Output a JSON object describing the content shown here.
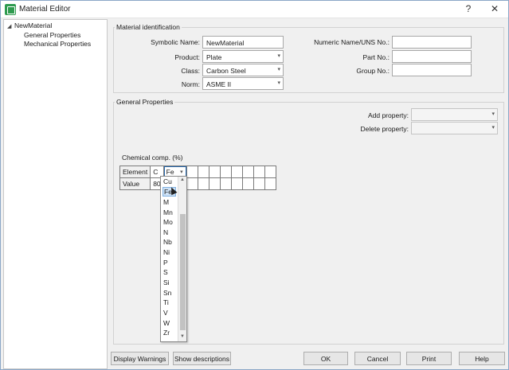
{
  "window": {
    "title": "Material Editor",
    "help_glyph": "?",
    "close_glyph": "✕"
  },
  "tree": {
    "root": "NewMaterial",
    "children": [
      "General Properties",
      "Mechanical Properties"
    ]
  },
  "identification": {
    "title": "Material identification",
    "symbolic_name_label": "Symbolic Name:",
    "symbolic_name_value": "NewMaterial",
    "product_label": "Product:",
    "product_value": "Plate",
    "class_label": "Class:",
    "class_value": "Carbon Steel",
    "norm_label": "Norm:",
    "norm_value": "ASME II",
    "numeric_name_label": "Numeric Name/UNS No.:",
    "numeric_name_value": "",
    "part_no_label": "Part No.:",
    "part_no_value": "",
    "group_no_label": "Group No.:",
    "group_no_value": ""
  },
  "general": {
    "title": "General Properties",
    "add_property_label": "Add property:",
    "delete_property_label": "Delete property:"
  },
  "chem": {
    "title": "Chemical comp. (%)",
    "element_label": "Element",
    "value_label": "Value",
    "elements": [
      "C",
      "Fe"
    ],
    "values": [
      "80",
      ""
    ]
  },
  "dropdown": {
    "items": [
      "Cu",
      "Fe",
      "M",
      "Mn",
      "Mo",
      "N",
      "Nb",
      "Ni",
      "P",
      "S",
      "Si",
      "Sn",
      "Ti",
      "V",
      "W",
      "Zr"
    ],
    "selected": "Fe"
  },
  "buttons": {
    "display_warnings": "Display Warnings",
    "show_descriptions": "Show descriptions",
    "ok": "OK",
    "cancel": "Cancel",
    "print": "Print",
    "help": "Help"
  },
  "icons": {
    "dropdown_arrow": "chevron-down-icon",
    "tree_expand": "expand-arrow-icon",
    "app": "app-icon"
  }
}
